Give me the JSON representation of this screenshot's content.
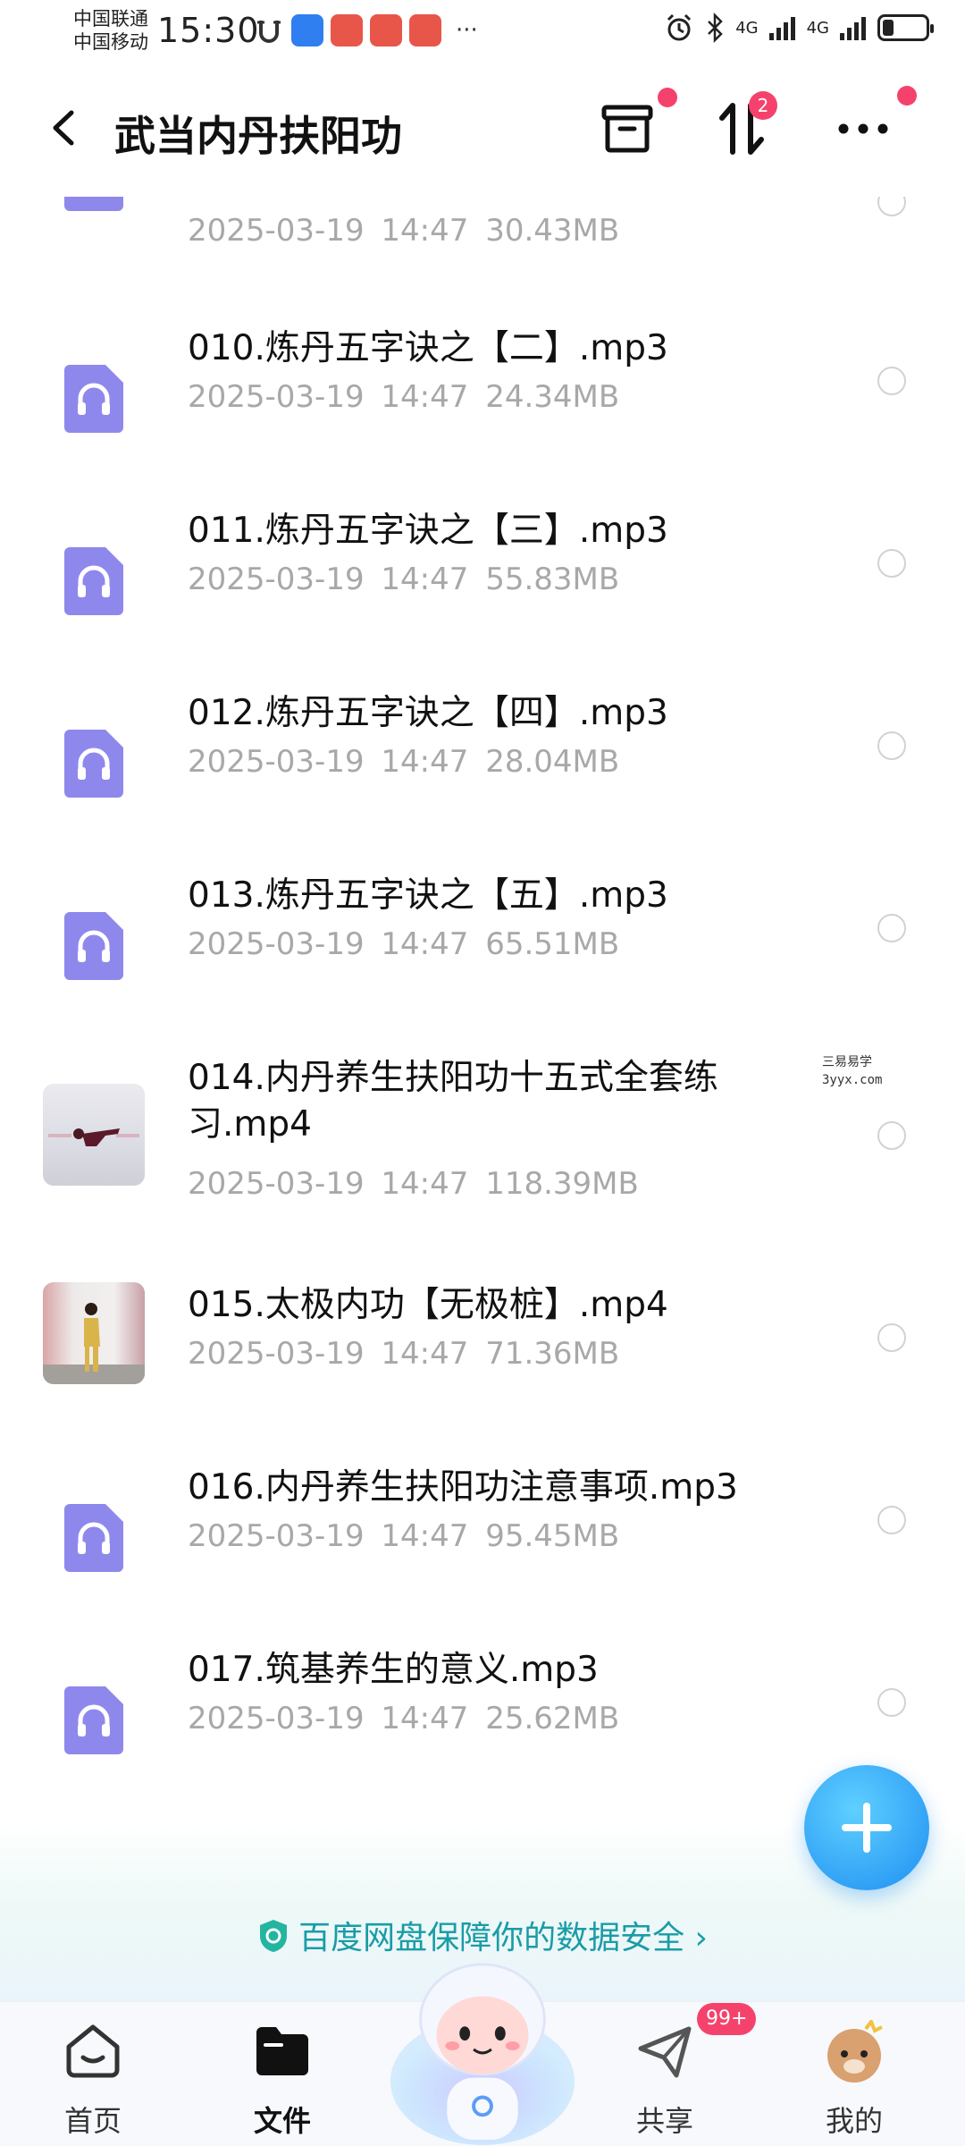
{
  "status_bar": {
    "carrier_1": "中国联通",
    "carrier_2": "中国移动",
    "time": "15:30",
    "signal_1": "4G",
    "signal_2": "4G",
    "battery_level": 0.25
  },
  "header": {
    "title": "武当内丹扶阳功",
    "back_icon": "chevron-left-icon",
    "actions": [
      {
        "name": "archive-icon",
        "has_dot": true
      },
      {
        "name": "transfer-icon",
        "badge": "2"
      },
      {
        "name": "more-icon",
        "has_dot": true
      }
    ]
  },
  "files": [
    {
      "name": "",
      "date": "2025-03-19",
      "time": "14:47",
      "size": "30.43MB",
      "kind": "audio"
    },
    {
      "name": "010.炼丹五字诀之【二】.mp3",
      "date": "2025-03-19",
      "time": "14:47",
      "size": "24.34MB",
      "kind": "audio"
    },
    {
      "name": "011.炼丹五字诀之【三】.mp3",
      "date": "2025-03-19",
      "time": "14:47",
      "size": "55.83MB",
      "kind": "audio"
    },
    {
      "name": "012.炼丹五字诀之【四】.mp3",
      "date": "2025-03-19",
      "time": "14:47",
      "size": "28.04MB",
      "kind": "audio"
    },
    {
      "name": "013.炼丹五字诀之【五】.mp3",
      "date": "2025-03-19",
      "time": "14:47",
      "size": "65.51MB",
      "kind": "audio"
    },
    {
      "name": "014.内丹养生扶阳功十五式全套练习.mp4",
      "date": "2025-03-19",
      "time": "14:47",
      "size": "118.39MB",
      "kind": "video"
    },
    {
      "name": "015.太极内功【无极桩】.mp4",
      "date": "2025-03-19",
      "time": "14:47",
      "size": "71.36MB",
      "kind": "video"
    },
    {
      "name": "016.内丹养生扶阳功注意事项.mp3",
      "date": "2025-03-19",
      "time": "14:47",
      "size": "95.45MB",
      "kind": "audio"
    },
    {
      "name": "017.筑基养生的意义.mp3",
      "date": "2025-03-19",
      "time": "14:47",
      "size": "25.62MB",
      "kind": "audio"
    }
  ],
  "watermark": {
    "line1": "三易易学",
    "line2": "3yyx.com"
  },
  "safety_banner": "百度网盘保障你的数据安全",
  "tabs": [
    {
      "label": "首页",
      "icon": "home-icon"
    },
    {
      "label": "文件",
      "icon": "folder-icon",
      "active": true
    },
    {
      "label": "共享",
      "icon": "send-icon",
      "badge": "99+"
    },
    {
      "label": "我的",
      "icon": "avatar-icon"
    }
  ],
  "colors": {
    "accent": "#1e8ef2",
    "audio_icon": "#8f88ec",
    "badge": "#f5426c",
    "meta_text": "#a8a8a8"
  }
}
